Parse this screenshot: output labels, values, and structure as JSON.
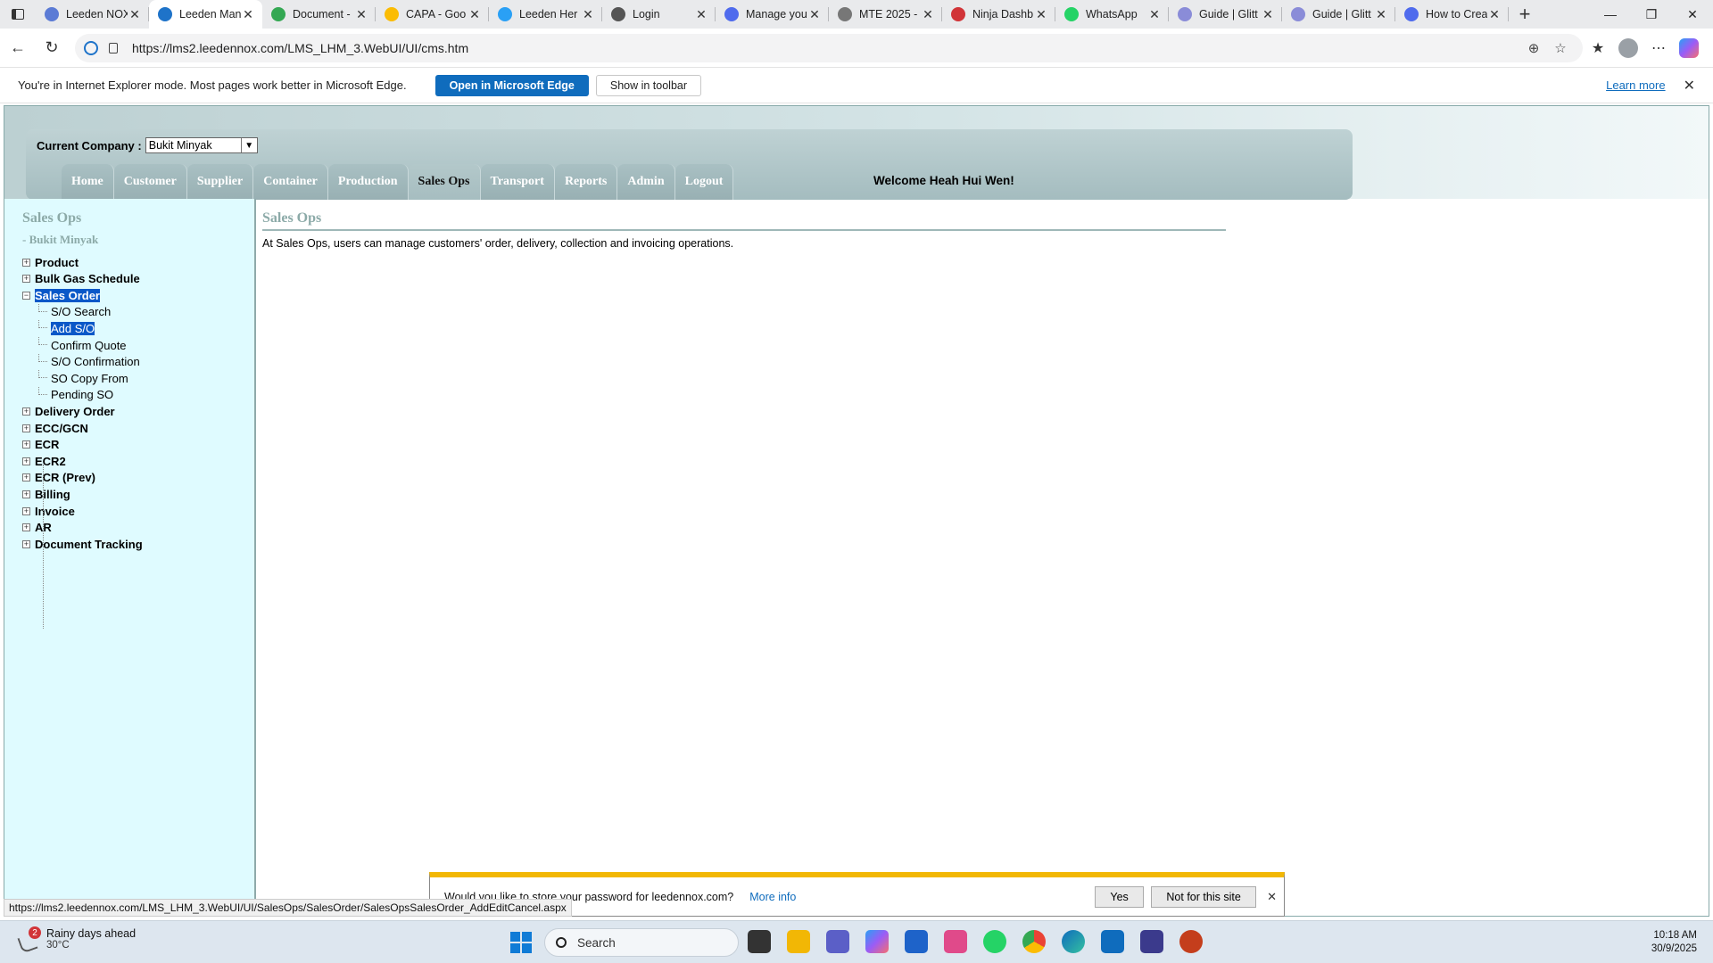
{
  "browser": {
    "tabs": [
      {
        "title": "Leeden NOX",
        "fav": "#5b7bd5"
      },
      {
        "title": "Leeden Man",
        "fav": "#1e73c9",
        "active": true
      },
      {
        "title": "Document -",
        "fav": "#34a853"
      },
      {
        "title": "CAPA - Goo",
        "fav": "#fbbc04"
      },
      {
        "title": "Leeden Her",
        "fav": "#2aa0f5"
      },
      {
        "title": "Login",
        "fav": "#555555"
      },
      {
        "title": "Manage you",
        "fav": "#4f6bed"
      },
      {
        "title": "MTE 2025 -",
        "fav": "#777777"
      },
      {
        "title": "Ninja Dashb",
        "fav": "#d13438"
      },
      {
        "title": "WhatsApp",
        "fav": "#25d366"
      },
      {
        "title": "Guide | Glitt",
        "fav": "#8a8cd8"
      },
      {
        "title": "Guide | Glitt",
        "fav": "#8a8cd8"
      },
      {
        "title": "How to Crea",
        "fav": "#4f6bed"
      }
    ],
    "url": "https://lms2.leedennox.com/LMS_LHM_3.WebUI/UI/cms.htm"
  },
  "ie_banner": {
    "message": "You're in Internet Explorer mode. Most pages work better in Microsoft Edge.",
    "open_edge": "Open in Microsoft Edge",
    "show_toolbar": "Show in toolbar",
    "learn_more": "Learn more"
  },
  "header": {
    "company_label": "Current Company :",
    "company_value": "Bukit Minyak",
    "menu": [
      "Home",
      "Customer",
      "Supplier",
      "Container",
      "Production",
      "Sales Ops",
      "Transport",
      "Reports",
      "Admin",
      "Logout"
    ],
    "active_menu": "Sales Ops",
    "welcome": "Welcome Heah Hui Wen!"
  },
  "sidebar": {
    "title": "Sales Ops",
    "subtitle": "- Bukit Minyak",
    "nodes_top": [
      "Product",
      "Bulk Gas Schedule"
    ],
    "expanded": "Sales Order",
    "children": [
      "S/O Search",
      "Add S/O",
      "Confirm Quote",
      "S/O Confirmation",
      "SO Copy From",
      "Pending SO"
    ],
    "selected_child": "Add S/O",
    "nodes_bottom": [
      "Delivery Order",
      "ECC/GCN",
      "ECR",
      "ECR2",
      "ECR (Prev)",
      "Billing",
      "Invoice",
      "AR",
      "Document Tracking"
    ]
  },
  "content": {
    "title": "Sales Ops",
    "description": "At Sales Ops, users can manage customers' order, delivery, collection and invoicing operations."
  },
  "password_bar": {
    "message": "Would you like to store your password for leedennox.com?",
    "more_info": "More info",
    "yes": "Yes",
    "no": "Not for this site"
  },
  "status_url": "https://lms2.leedennox.com/LMS_LHM_3.WebUI/UI/SalesOps/SalesOrder/SalesOpsSalesOrder_AddEditCancel.aspx",
  "taskbar": {
    "weather_title": "Rainy days ahead",
    "weather_temp": "30°C",
    "weather_badge": "2",
    "search_placeholder": "Search",
    "time": "10:18 AM",
    "date": "30/9/2025"
  }
}
